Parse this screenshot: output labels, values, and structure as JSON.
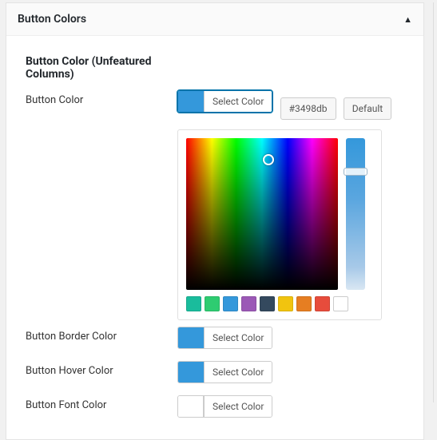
{
  "panel": {
    "title": "Button Colors"
  },
  "section": {
    "title": "Button Color (Unfeatured Columns)"
  },
  "common": {
    "select_color": "Select Color",
    "default": "Default"
  },
  "fields": {
    "button_color": {
      "label": "Button Color",
      "hex": "#3498db",
      "swatch": "#3498db"
    },
    "border": {
      "label": "Button Border Color",
      "swatch": "#3498db"
    },
    "hover": {
      "label": "Button Hover Color",
      "swatch": "#3498db"
    },
    "font": {
      "label": "Button Font Color",
      "swatch": "#ffffff"
    }
  },
  "presets": [
    "#1abc9c",
    "#2ecc71",
    "#3498db",
    "#9b59b6",
    "#34495e",
    "#f1c40f",
    "#e67e22",
    "#e74c3c",
    "#ffffff"
  ]
}
